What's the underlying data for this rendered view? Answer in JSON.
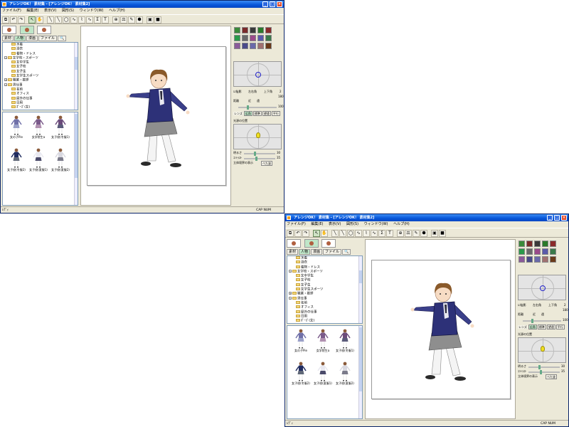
{
  "window": {
    "title": "アレンジOK！ 素材集 - [アレンジOK！ 素材集2]",
    "buttons": [
      "_",
      "□",
      "×"
    ]
  },
  "menu": [
    "ファイル(F)",
    "編集(E)",
    "表示(V)",
    "図形(S)",
    "ウィンドウ(W)",
    "ヘルプ(H)"
  ],
  "toolbar": {
    "icons": [
      "copy-icon",
      "undo-icon",
      "redo-icon",
      "pointer-icon",
      "hand-icon",
      "line-icon",
      "diagonal-icon",
      "ellipse-icon",
      "curve-icon",
      "polygon-icon",
      "freehand-icon",
      "sigma-icon",
      "text-icon",
      "rotate-icon",
      "balance-icon",
      "pen-icon",
      "fill-icon",
      "image-icon",
      "record-icon"
    ],
    "glyphs": [
      "⧉",
      "↶",
      "↷",
      "↖",
      "✋",
      "╲",
      "╲",
      "◯",
      "∿",
      "⌇",
      "∿",
      "Σ",
      "T",
      "⊕",
      "⚖",
      "✎",
      "⬢",
      "▣",
      "■"
    ]
  },
  "left": {
    "subtabs": [
      "素材",
      "人物",
      "漫画",
      "ファイル",
      "🔍"
    ],
    "active_subtab": 1,
    "tree": [
      {
        "label": "水着",
        "level": 2
      },
      {
        "label": "浴衣",
        "level": 2
      },
      {
        "label": "着物・ドレス",
        "level": 2
      },
      {
        "label": "女学校・スポーツ",
        "level": 1,
        "expanded": true
      },
      {
        "label": "女中学生",
        "level": 2
      },
      {
        "label": "女子校",
        "level": 2
      },
      {
        "label": "女子生",
        "level": 2
      },
      {
        "label": "女学生スポーツ",
        "level": 2
      },
      {
        "label": "職業・挨拶",
        "level": 1,
        "expanded": false
      },
      {
        "label": "男仕事",
        "level": 1,
        "expanded": true
      },
      {
        "label": "名前",
        "level": 2
      },
      {
        "label": "オフィス",
        "level": 2
      },
      {
        "label": "屋外の仕事",
        "level": 2
      },
      {
        "label": "日用",
        "level": 2
      },
      {
        "label": "ﾎﾟｰｽﾞ(女)",
        "level": 2
      }
    ],
    "poses": [
      {
        "label": "女の子Pie",
        "color": "#7070a8",
        "skirt": "#9aa0c8"
      },
      {
        "label": "女学院生a",
        "color": "#7a5a8a",
        "skirt": "#b090b0"
      },
      {
        "label": "女子校(冬服1)",
        "color": "#6a4a7a",
        "skirt": "#5a5a7a"
      },
      {
        "label": "女子校(冬服2)",
        "color": "#202c60",
        "skirt": "#606878"
      },
      {
        "label": "女子校(夏服1)",
        "color": "#e8e8f0",
        "skirt": "#4a4a6a"
      },
      {
        "label": "女子校(夏服2)",
        "color": "#d8d8e0",
        "skirt": "#7a7a8a"
      }
    ]
  },
  "right": {
    "swatch_colors": [
      "#3a8a3a",
      "#7a2a2a",
      "#3a3a3a",
      "#2a7a2a",
      "#8a2a2a",
      "#2a9a4a",
      "#6a6a6a",
      "#9a4a8a",
      "#5a5aaa",
      "#3a7a4a",
      "#8a5a9a",
      "#4a4a8a",
      "#6a6aaa",
      "#a07070",
      "#6a3a1a"
    ],
    "shade_label": "☑陰影",
    "angle_labels": [
      "左右角",
      "上下角"
    ],
    "distance_label": "距離",
    "near_far": [
      "近",
      "遠"
    ],
    "value_top": "2",
    "value_mid": "180",
    "value_low": "100",
    "lens_label": "レンズ",
    "lens_buttons": [
      "広角",
      "標準",
      "望遠",
      "平行"
    ],
    "light_section": "光源の位置",
    "brightness_label": "明るさ",
    "contrast_label": "ｺﾝﾄﾗｽﾄ",
    "brightness_value": "30",
    "contrast_value": "35",
    "outline_label": "立体境界の表示",
    "outline_button": "べた塗"
  },
  "status": {
    "left": "ﾚﾃﾞｨ",
    "right": "CAP  NUM"
  }
}
